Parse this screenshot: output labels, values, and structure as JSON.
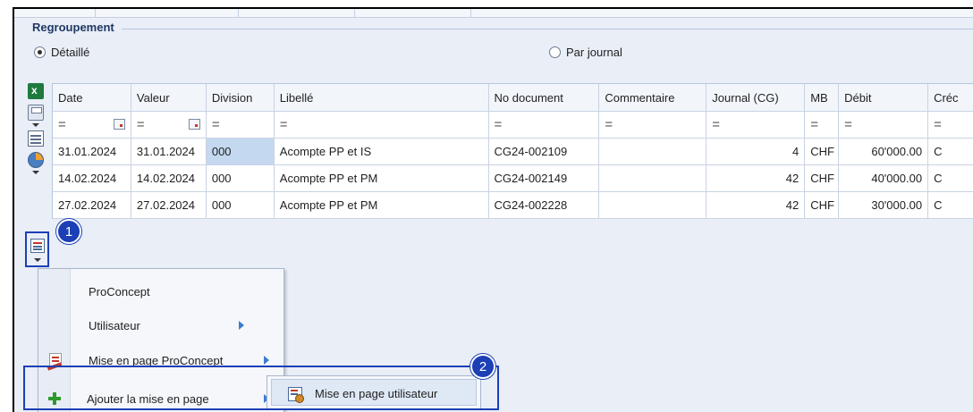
{
  "group": {
    "title": "Regroupement"
  },
  "radios": [
    {
      "label": "Détaillé",
      "checked": true
    },
    {
      "label": "Par journal",
      "checked": false
    }
  ],
  "grid": {
    "columns": [
      "Date",
      "Valeur",
      "Division",
      "Libellé",
      "No document",
      "Commentaire",
      "Journal (CG)",
      "MB",
      "Débit",
      "Créc"
    ],
    "filter_symbol": "=",
    "rows": [
      [
        "31.01.2024",
        "31.01.2024",
        "000",
        "Acompte PP et IS",
        "CG24-002109",
        "",
        "4",
        "CHF",
        "60'000.00",
        "C"
      ],
      [
        "14.02.2024",
        "14.02.2024",
        "000",
        "Acompte PP et PM",
        "CG24-002149",
        "",
        "42",
        "CHF",
        "40'000.00",
        "C"
      ],
      [
        "27.02.2024",
        "27.02.2024",
        "000",
        "Acompte PP et PM",
        "CG24-002228",
        "",
        "42",
        "CHF",
        "30'000.00",
        "C"
      ]
    ]
  },
  "badges": [
    "1",
    "2"
  ],
  "menu": {
    "items": [
      {
        "label": "ProConcept",
        "submenu": false
      },
      {
        "label": "Utilisateur",
        "submenu": true
      },
      {
        "label": "Mise en page ProConcept",
        "submenu": true
      },
      {
        "label": "Ajouter la mise en page",
        "submenu": true
      }
    ]
  },
  "submenu": {
    "label": "Mise en page utilisateur"
  },
  "icons": {
    "toolbar": [
      "excel-icon",
      "save-layout-icon",
      "list-view-icon",
      "chart-icon",
      "layout-icon"
    ],
    "menu": [
      "pdf-layout-icon",
      "add-icon"
    ],
    "submenu": [
      "user-layout-icon"
    ]
  },
  "colors": {
    "highlight": "#1c3fb5",
    "selection": "#c4d8f0",
    "background": "#e9eef7"
  }
}
